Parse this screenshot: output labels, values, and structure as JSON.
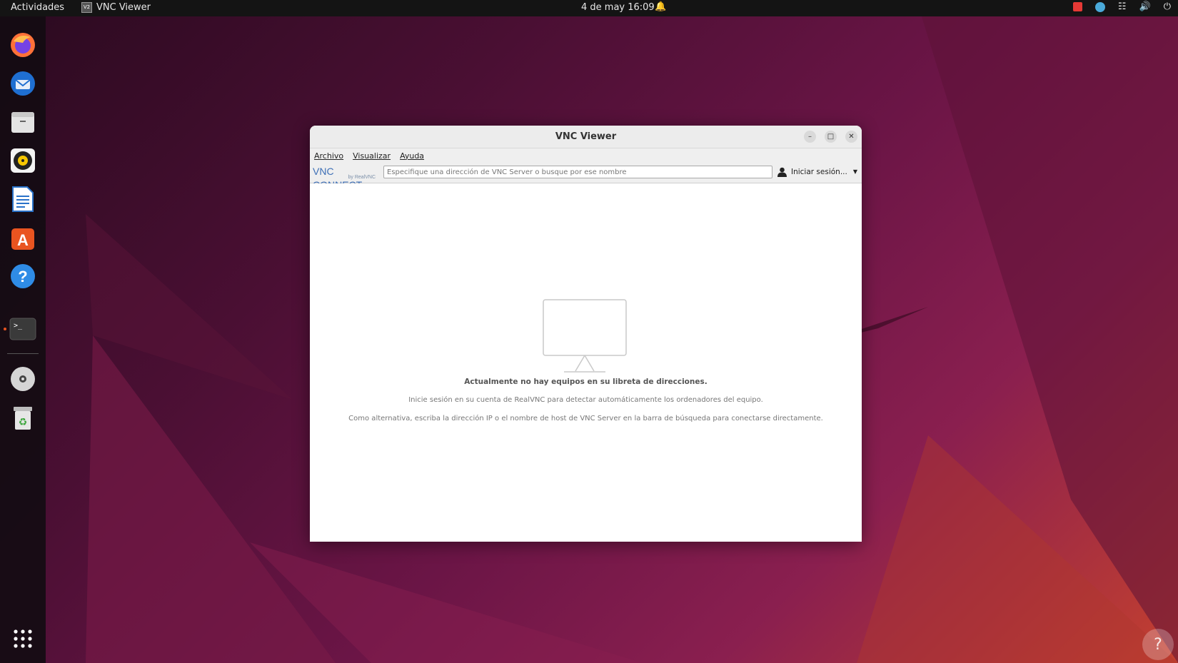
{
  "topbar": {
    "activities": "Actividades",
    "app_name": "VNC Viewer",
    "app_icon_text": "V2",
    "clock": "4 de may  16:09",
    "tray_icons": [
      "vnc-server-icon",
      "vnc-viewer-tray-icon",
      "network-icon",
      "volume-icon",
      "power-icon"
    ]
  },
  "dock": {
    "items": [
      {
        "name": "firefox-icon"
      },
      {
        "name": "thunderbird-icon"
      },
      {
        "name": "files-icon"
      },
      {
        "name": "rhythmbox-icon"
      },
      {
        "name": "libreoffice-writer-icon"
      },
      {
        "name": "software-center-icon"
      },
      {
        "name": "help-icon"
      },
      {
        "name": "terminal-icon"
      },
      {
        "name": "disc-icon"
      },
      {
        "name": "trash-icon"
      },
      {
        "name": "show-apps-icon"
      }
    ]
  },
  "window": {
    "title": "VNC Viewer",
    "menu": {
      "archivo": "Archivo",
      "visualizar": "Visualizar",
      "ayuda": "Ayuda"
    },
    "logo": {
      "main": "VNC CONNECT",
      "sub": "by RealVNC"
    },
    "search": {
      "placeholder": "Especifique una dirección de VNC Server o busque por ese nombre",
      "value": ""
    },
    "signin_label": "Iniciar sesión...",
    "empty_state": {
      "title": "Actualmente no hay equipos en su libreta de direcciones.",
      "line1": "Inicie sesión en su cuenta de RealVNC para detectar automáticamente los ordenadores del equipo.",
      "line2": "Como alternativa, escriba la dirección IP o el nombre de host de VNC Server en la barra de búsqueda para conectarse directamente."
    }
  },
  "colors": {
    "accent": "#e95420",
    "vnc_blue": "#3d6fb6"
  }
}
